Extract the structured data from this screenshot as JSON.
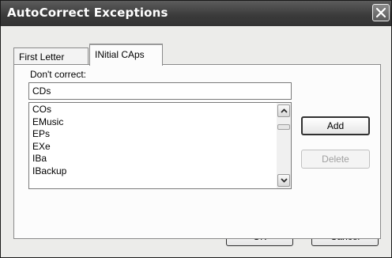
{
  "dialog": {
    "title": "AutoCorrect Exceptions"
  },
  "tabs": [
    {
      "label": "First Letter",
      "active": false
    },
    {
      "label": "INitial CAps",
      "active": true
    }
  ],
  "panel": {
    "label": "Don't correct:",
    "input_value": "CDs",
    "list_items": [
      "COs",
      "EMusic",
      "EPs",
      "EXe",
      "IBa",
      "IBackup"
    ]
  },
  "buttons": {
    "add": "Add",
    "delete": "Delete",
    "ok": "OK",
    "cancel": "Cancel"
  },
  "icons": {
    "close": "close-icon",
    "scroll_up": "arrow-up-icon",
    "scroll_down": "arrow-down-icon"
  }
}
